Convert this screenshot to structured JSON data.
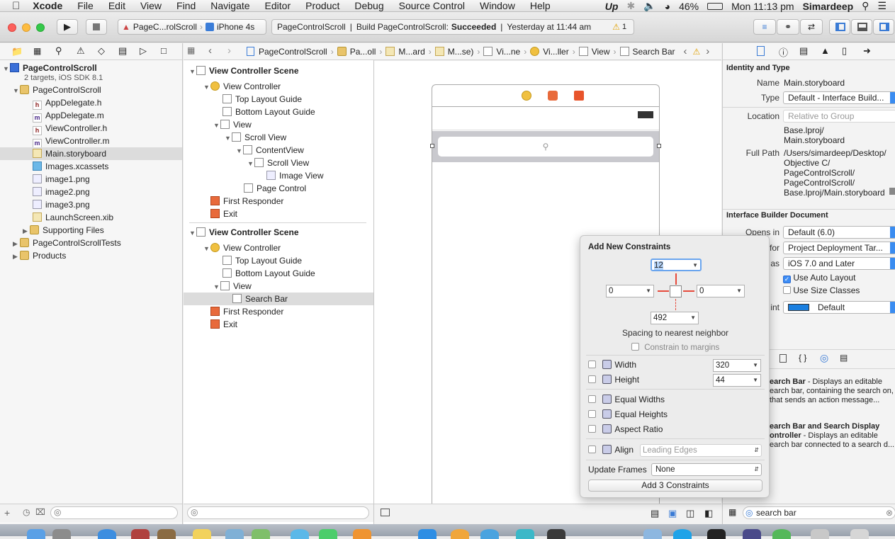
{
  "menubar": {
    "app_name": "Xcode",
    "items": [
      "File",
      "Edit",
      "View",
      "Find",
      "Navigate",
      "Editor",
      "Product",
      "Debug",
      "Source Control",
      "Window",
      "Help"
    ],
    "battery": "46%",
    "clock": "Mon 11:13 pm",
    "user": "Simardeep"
  },
  "toolbar": {
    "scheme": "PageC...rolScroll",
    "device": "iPhone 4s",
    "activity_project": "PageControlScroll",
    "activity_build_prefix": "Build PageControlScroll:",
    "activity_build_status": "Succeeded",
    "activity_time": "Yesterday at 11:44 am",
    "warning_count": "1"
  },
  "navigator": {
    "project_name": "PageControlScroll",
    "project_sub": "2 targets, iOS SDK 8.1",
    "items": [
      {
        "label": "PageControlScroll",
        "type": "folder"
      },
      {
        "label": "AppDelegate.h",
        "type": "h"
      },
      {
        "label": "AppDelegate.m",
        "type": "m"
      },
      {
        "label": "ViewController.h",
        "type": "h"
      },
      {
        "label": "ViewController.m",
        "type": "m"
      },
      {
        "label": "Main.storyboard",
        "type": "ib"
      },
      {
        "label": "Images.xcassets",
        "type": "assets"
      },
      {
        "label": "image1.png",
        "type": "png"
      },
      {
        "label": "image2.png",
        "type": "png"
      },
      {
        "label": "image3.png",
        "type": "png"
      },
      {
        "label": "LaunchScreen.xib",
        "type": "ib"
      },
      {
        "label": "Supporting Files",
        "type": "folder"
      },
      {
        "label": "PageControlScrollTests",
        "type": "folder"
      },
      {
        "label": "Products",
        "type": "folder"
      }
    ]
  },
  "outline": {
    "items": [
      {
        "label": "View Controller Scene",
        "bold": true
      },
      {
        "label": "View Controller"
      },
      {
        "label": "Top Layout Guide"
      },
      {
        "label": "Bottom Layout Guide"
      },
      {
        "label": "View"
      },
      {
        "label": "Scroll View"
      },
      {
        "label": "ContentView"
      },
      {
        "label": "Scroll View"
      },
      {
        "label": "Image View"
      },
      {
        "label": "Page Control"
      },
      {
        "label": "First Responder"
      },
      {
        "label": "Exit"
      },
      {
        "label": "View Controller Scene",
        "bold": true
      },
      {
        "label": "View Controller"
      },
      {
        "label": "Top Layout Guide"
      },
      {
        "label": "Bottom Layout Guide"
      },
      {
        "label": "View"
      },
      {
        "label": "Search Bar"
      },
      {
        "label": "First Responder"
      },
      {
        "label": "Exit"
      }
    ]
  },
  "jumpbar": [
    "PageControlScroll",
    "Pa...oll",
    "M...ard",
    "M...se)",
    "Vi...ne",
    "Vi...ller",
    "View",
    "Search Bar"
  ],
  "constraints": {
    "title": "Add New Constraints",
    "top": "12",
    "left": "0",
    "right": "0",
    "bottom": "492",
    "spacing_label": "Spacing to nearest neighbor",
    "constrain_margins": "Constrain to margins",
    "width_label": "Width",
    "width_value": "320",
    "height_label": "Height",
    "height_value": "44",
    "equal_widths": "Equal Widths",
    "equal_heights": "Equal Heights",
    "aspect_ratio": "Aspect Ratio",
    "align_label": "Align",
    "align_value": "Leading Edges",
    "update_frames_label": "Update Frames",
    "update_frames_value": "None",
    "add_button": "Add 3 Constraints"
  },
  "inspector": {
    "identity_header": "Identity and Type",
    "name_label": "Name",
    "name_value": "Main.storyboard",
    "type_label": "Type",
    "type_value": "Default - Interface Build...",
    "location_label": "Location",
    "location_value": "Relative to Group",
    "location_path1": "Base.lproj/",
    "location_path2": "Main.storyboard",
    "fullpath_label": "Full Path",
    "fullpath_lines": [
      "/Users/simardeep/Desktop/",
      "Objective C/",
      "PageControlScroll/",
      "PageControlScroll/",
      "Base.lproj/Main.storyboard"
    ],
    "ibdoc_header": "Interface Builder Document",
    "opens_in_label": "Opens in",
    "opens_in_value": "Default (6.0)",
    "builds_for_label": "for",
    "builds_for_value": "Project Deployment Tar...",
    "view_as_label": "as",
    "view_as_value": "iOS 7.0 and Later",
    "auto_layout": "Use Auto Layout",
    "size_classes": "Use Size Classes",
    "tint_label": "int",
    "tint_value": "Default",
    "library": [
      {
        "title": "earch Bar",
        "desc": " - Displays an editable earch bar, containing the search on, that sends an action message..."
      },
      {
        "title": "earch Bar and Search Display ontroller",
        "desc": " - Displays an editable earch bar connected to a search d..."
      }
    ],
    "library_search": "search bar"
  }
}
